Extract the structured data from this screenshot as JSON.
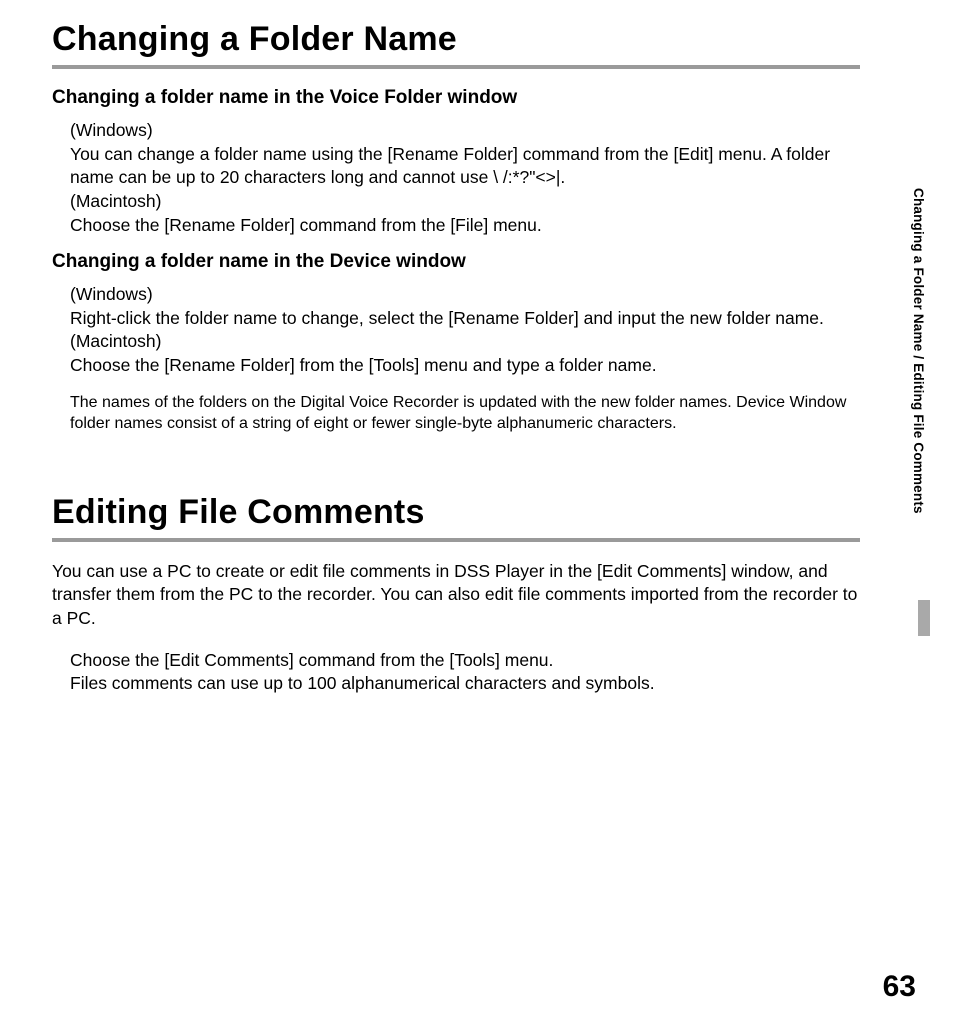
{
  "page_number": "63",
  "side_header": "Changing a Folder Name / Editing File Comments",
  "section1": {
    "title": "Changing a Folder Name",
    "sub1": {
      "heading": "Changing a folder name in the Voice Folder window",
      "win_label": "(Windows)",
      "win_body": "You can change a folder name using the [Rename Folder] command from the [Edit] menu. A folder name can be up to 20 characters long and cannot use \\ /:*?\"<>|.",
      "mac_label": "(Macintosh)",
      "mac_body": "Choose the [Rename Folder] command from the [File] menu."
    },
    "sub2": {
      "heading": "Changing a folder name in the Device window",
      "win_label": "(Windows)",
      "win_body": "Right-click the folder name to change, select the [Rename Folder] and input the new folder name.",
      "mac_label": "(Macintosh)",
      "mac_body": "Choose the [Rename Folder] from the [Tools] menu and type a folder name.",
      "note": "The names of the folders on  the Digital Voice Recorder is updated with the new folder names. Device Window folder names consist of a string of eight or fewer single-byte alphanumeric characters."
    }
  },
  "section2": {
    "title": "Editing File Comments",
    "intro": "You can use a PC to create or edit file comments in DSS Player in the [Edit Comments] window, and transfer them from the PC to the recorder. You can also edit file comments imported from the recorder to a PC.",
    "body1": "Choose the [Edit Comments] command from the [Tools] menu.",
    "body2": "Files comments can use up to 100 alphanumerical characters and symbols."
  }
}
